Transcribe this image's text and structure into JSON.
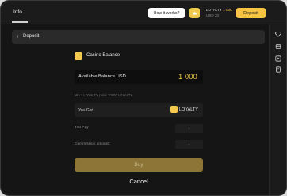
{
  "topbar": {
    "tab_label": "Info",
    "how_button": "How it works?",
    "loyalty_label": "LOYALTY",
    "loyalty_value": "1 000",
    "usd_value": "USD 20",
    "deposit_button": "Deposit"
  },
  "sidebar": {
    "icons": [
      "diamond-icon",
      "open-box-icon",
      "play-icon",
      "receipt-icon"
    ]
  },
  "header": {
    "title": "Deposit"
  },
  "casino": {
    "title": "Casino Balance"
  },
  "balance": {
    "label": "Available Balance USD",
    "value": "1 000"
  },
  "limits": "Min 1 LOYALTY | Max 10000 LOYALTY",
  "get": {
    "label": "You Get",
    "currency": "LOYALTY"
  },
  "pay": {
    "label": "You Pay",
    "value": "-"
  },
  "commission": {
    "label": "Commission amount:",
    "value": "-"
  },
  "actions": {
    "buy": "Buy",
    "cancel": "Cancel"
  },
  "colors": {
    "accent": "#f6c343",
    "background": "#151515",
    "buy_disabled": "#8c7537"
  }
}
